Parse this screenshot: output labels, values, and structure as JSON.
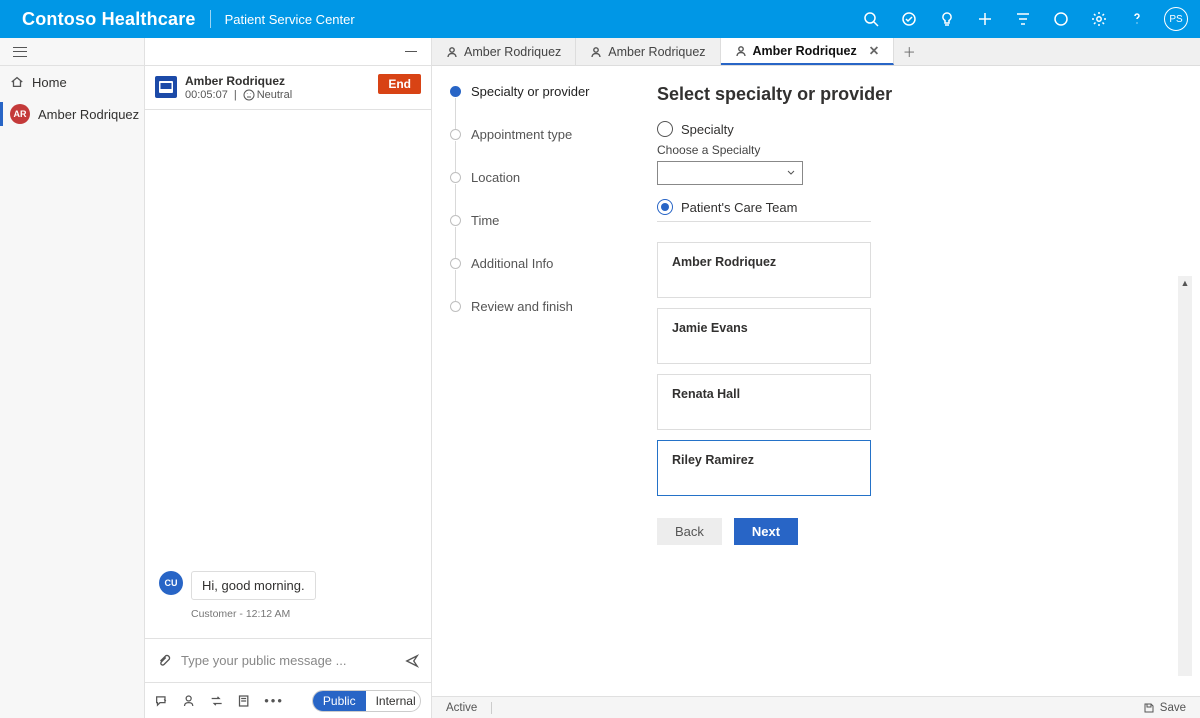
{
  "header": {
    "brand": "Contoso Healthcare",
    "product": "Patient Service Center",
    "avatar_initials": "PS"
  },
  "rail": {
    "home_label": "Home",
    "session_label": "Amber Rodriquez",
    "session_initials": "AR"
  },
  "chat": {
    "customer_name": "Amber Rodriquez",
    "timer": "00:05:07",
    "sentiment": "Neutral",
    "end_label": "End",
    "msg_initials": "CU",
    "msg_text": "Hi, good morning.",
    "msg_meta": "Customer - 12:12 AM",
    "input_placeholder": "Type your public message ...",
    "pill_public": "Public",
    "pill_internal": "Internal"
  },
  "tabs": [
    {
      "label": "Amber Rodriquez",
      "active": false,
      "closable": false
    },
    {
      "label": "Amber Rodriquez",
      "active": false,
      "closable": false
    },
    {
      "label": "Amber Rodriquez",
      "active": true,
      "closable": true
    }
  ],
  "steps": [
    {
      "label": "Specialty or provider",
      "active": true
    },
    {
      "label": "Appointment type",
      "active": false
    },
    {
      "label": "Location",
      "active": false
    },
    {
      "label": "Time",
      "active": false
    },
    {
      "label": "Additional Info",
      "active": false
    },
    {
      "label": "Review and finish",
      "active": false
    }
  ],
  "form": {
    "title": "Select specialty or provider",
    "opt_specialty": "Specialty",
    "specialty_field_label": "Choose a Specialty",
    "specialty_value": "",
    "opt_careteam": "Patient's Care Team",
    "cards": [
      {
        "name": "Amber Rodriquez",
        "selected": false
      },
      {
        "name": "Jamie Evans",
        "selected": false
      },
      {
        "name": "Renata Hall",
        "selected": false
      },
      {
        "name": "Riley Ramirez",
        "selected": true
      }
    ],
    "btn_back": "Back",
    "btn_next": "Next"
  },
  "status": {
    "state": "Active",
    "save": "Save"
  }
}
